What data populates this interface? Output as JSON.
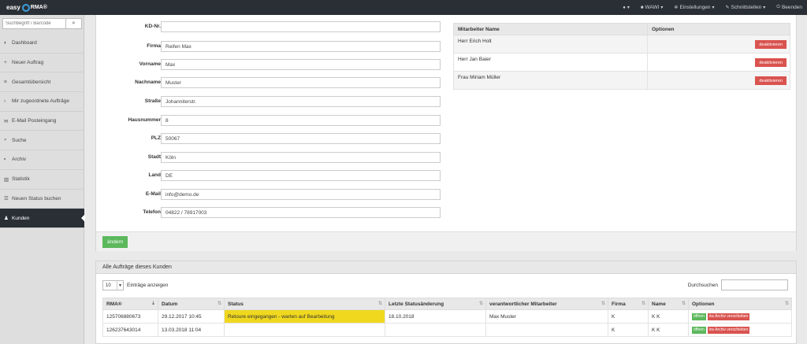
{
  "app": {
    "logo_easy": "easy",
    "logo_rma": "RMA",
    "logo_reg": "®"
  },
  "topnav": {
    "globe": "",
    "wawi": "WAWI",
    "settings": "Einstellungen",
    "interfaces": "Schnittstellen",
    "quit": "Beenden"
  },
  "sidebar": {
    "search_placeholder": "Suchbegriff / Barcode",
    "items": [
      {
        "label": "Dashboard",
        "icon": "dashboard-icon",
        "glyph": "◐"
      },
      {
        "label": "Neuer Auftrag",
        "icon": "plus-icon",
        "glyph": "+"
      },
      {
        "label": "Gesamtübersicht",
        "icon": "list-icon",
        "glyph": "≡"
      },
      {
        "label": "Mir zugeordnete Aufträge",
        "icon": "chevron-right-icon",
        "glyph": "›"
      },
      {
        "label": "E-Mail Posteingang",
        "icon": "envelope-icon",
        "glyph": "✉"
      },
      {
        "label": "Suche",
        "icon": "search-icon",
        "glyph": "⌕"
      },
      {
        "label": "Archiv",
        "icon": "archive-icon",
        "glyph": "▪"
      },
      {
        "label": "Statistik",
        "icon": "chart-icon",
        "glyph": "▥"
      },
      {
        "label": "Neuen Status buchen",
        "icon": "list-icon",
        "glyph": "☰"
      },
      {
        "label": "Kunden",
        "icon": "users-icon",
        "glyph": "♟"
      }
    ]
  },
  "customer_form": {
    "fields": [
      {
        "label": "KD-Nr.",
        "value": ""
      },
      {
        "label": "Firma",
        "value": "Reifen Max"
      },
      {
        "label": "Vorname",
        "value": "Max"
      },
      {
        "label": "Nachname",
        "value": "Muster"
      },
      {
        "label": "Straße",
        "value": "Johanniterstr."
      },
      {
        "label": "Hausnummer",
        "value": "8"
      },
      {
        "label": "PLZ",
        "value": "50067"
      },
      {
        "label": "Stadt",
        "value": "Köln"
      },
      {
        "label": "Land",
        "value": "DE"
      },
      {
        "label": "E-Mail",
        "value": "info@demo.de"
      },
      {
        "label": "Telefon",
        "value": "04822 / 78917003"
      }
    ],
    "submit_label": "ändern"
  },
  "employees": {
    "col_name": "Mitarbeiter Name",
    "col_options": "Optionen",
    "rows": [
      {
        "name": "Herr Erich Holt",
        "action": "deaktivieren"
      },
      {
        "name": "Herr Jan Baier",
        "action": "deaktivieren"
      },
      {
        "name": "Frau Miriam Müller",
        "action": "deaktivieren"
      }
    ]
  },
  "orders": {
    "title": "Alle Aufträge dieses Kunden",
    "page_length": "10",
    "page_length_suffix": "Einträge anzeigen",
    "search_label": "Durchsuchen",
    "columns": [
      "RMA®",
      "Datum",
      "Status",
      "Letzte Statusänderung",
      "verantwortlicher Mitarbeiter",
      "Firma",
      "Name",
      "Optionen"
    ],
    "rows": [
      {
        "rma": "125706880673",
        "date": "29.12.2017 10:45",
        "status": "Retoure eingegangen - warten auf Bearbeitung",
        "last_change": "18.10.2018",
        "employee": "Max Muster",
        "company": "K",
        "name": "K K",
        "open": "öffnen",
        "archive": "ins Archiv verschieben"
      },
      {
        "rma": "126237643014",
        "date": "13.03.2018 11:04",
        "status": "",
        "last_change": "",
        "employee": "",
        "company": "K",
        "name": "K K",
        "open": "öffnen",
        "archive": "ins Archiv verschieben"
      }
    ]
  }
}
